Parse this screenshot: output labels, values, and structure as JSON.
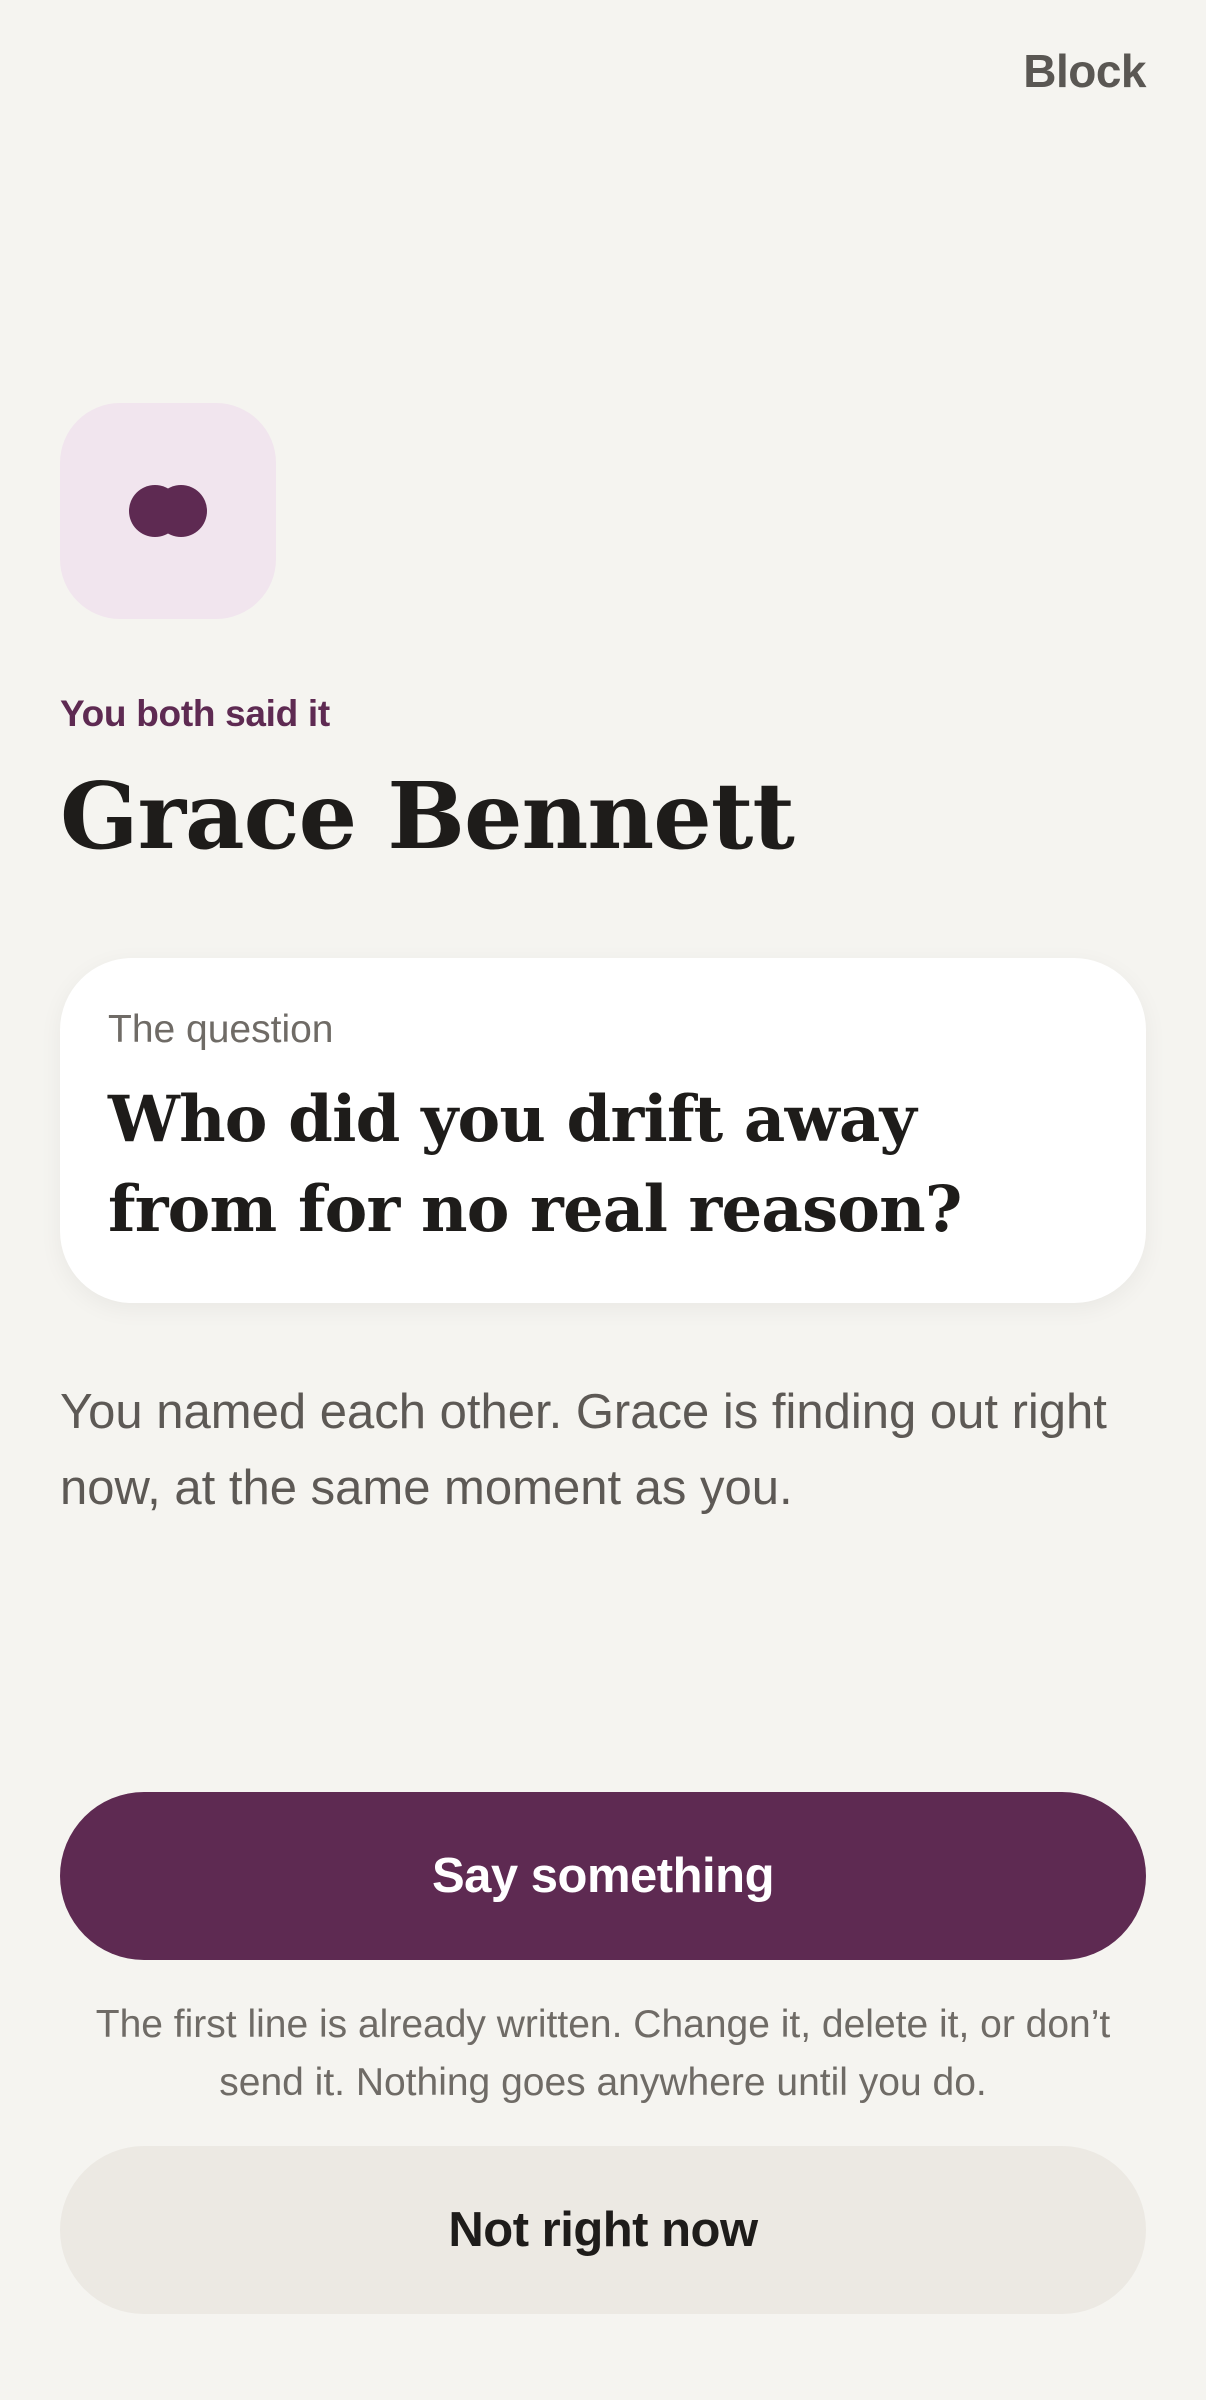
{
  "header": {
    "block_label": "Block"
  },
  "match_icon": {
    "name": "two-circles-match-icon",
    "tile_color": "#f1e5ee",
    "mark_color": "#5e2a52"
  },
  "match": {
    "eyebrow": "You both said it",
    "name": "Grace Bennett"
  },
  "question_card": {
    "label": "The question",
    "text": "Who did you drift away from for no real reason?"
  },
  "body": {
    "text": "You named each other. Grace is finding out right now, at the same moment as you."
  },
  "actions": {
    "primary_label": "Say something",
    "helper_text": "The first line is already written. Change it, delete it, or don’t send it. Nothing goes anywhere until you do.",
    "secondary_label": "Not right now"
  },
  "colors": {
    "background": "#f5f4f0",
    "accent": "#5e2a52",
    "card": "#ffffff",
    "secondary_button": "#ece9e3"
  }
}
